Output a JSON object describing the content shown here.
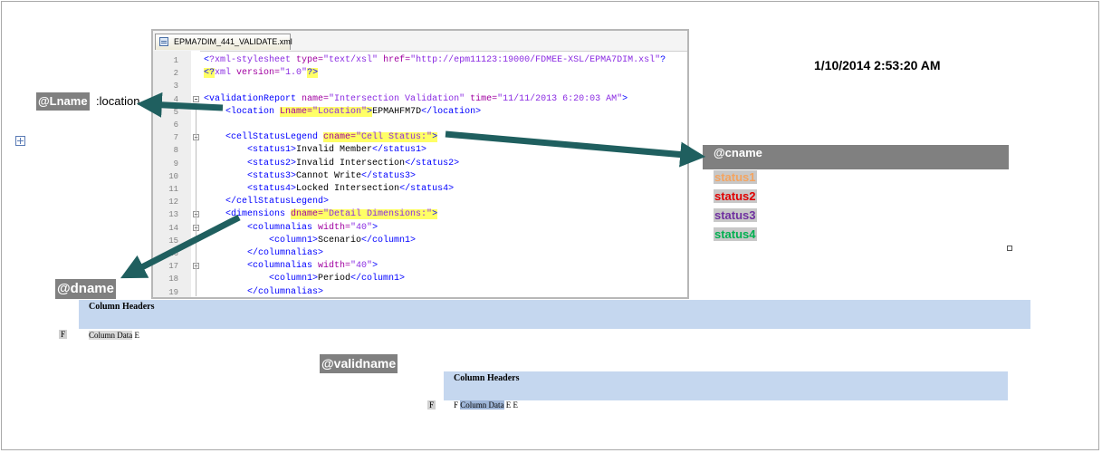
{
  "editor": {
    "tab_title": "EPMA7DIM_441_VALIDATE.xml",
    "lines": [
      {
        "num": "1",
        "parts": [
          {
            "t": "<",
            "c": "c-b"
          },
          {
            "t": "?xml-stylesheet ",
            "c": "c-m"
          },
          {
            "t": "type=",
            "c": "c-p"
          },
          {
            "t": "\"text/xsl\" ",
            "c": "c-m"
          },
          {
            "t": "href=",
            "c": "c-p"
          },
          {
            "t": "\"http://epm11123:19000/FDMEE-XSL/EPMA7DIM.xsl\"",
            "c": "c-m"
          },
          {
            "t": "?",
            "c": "c-b"
          }
        ]
      },
      {
        "num": "2",
        "parts": [
          {
            "t": "<?",
            "c": "c-b hl"
          },
          {
            "t": "xml ",
            "c": "c-m"
          },
          {
            "t": "version=",
            "c": "c-p"
          },
          {
            "t": "\"1.0\"",
            "c": "c-m"
          },
          {
            "t": "?>",
            "c": "c-b hl"
          }
        ]
      },
      {
        "num": "3",
        "parts": []
      },
      {
        "num": "4",
        "parts": [
          {
            "t": "<validationReport ",
            "c": "c-b"
          },
          {
            "t": "name=",
            "c": "c-p"
          },
          {
            "t": "\"Intersection Validation\" ",
            "c": "c-m"
          },
          {
            "t": "time=",
            "c": "c-p"
          },
          {
            "t": "\"11/11/2013 6:20:03 AM\"",
            "c": "c-m"
          },
          {
            "t": ">",
            "c": "c-b"
          }
        ]
      },
      {
        "num": "5",
        "parts": [
          {
            "t": "    <location ",
            "c": "c-b"
          },
          {
            "t": "Lname=",
            "c": "c-p hl"
          },
          {
            "t": "\"Location\"",
            "c": "c-m hl"
          },
          {
            "t": ">",
            "c": "c-b hl"
          },
          {
            "t": "EPMAHFM7D",
            "c": "c-k"
          },
          {
            "t": "</location>",
            "c": "c-b"
          }
        ]
      },
      {
        "num": "6",
        "parts": []
      },
      {
        "num": "7",
        "parts": [
          {
            "t": "    <cellStatusLegend ",
            "c": "c-b"
          },
          {
            "t": "cname=",
            "c": "c-p hl"
          },
          {
            "t": "\"Cell Status:\"",
            "c": "c-m hl"
          },
          {
            "t": ">",
            "c": "c-b hl"
          }
        ]
      },
      {
        "num": "8",
        "parts": [
          {
            "t": "        <status1>",
            "c": "c-b"
          },
          {
            "t": "Invalid Member",
            "c": "c-k"
          },
          {
            "t": "</status1>",
            "c": "c-b"
          }
        ]
      },
      {
        "num": "9",
        "parts": [
          {
            "t": "        <status2>",
            "c": "c-b"
          },
          {
            "t": "Invalid Intersection",
            "c": "c-k"
          },
          {
            "t": "</status2>",
            "c": "c-b"
          }
        ]
      },
      {
        "num": "10",
        "parts": [
          {
            "t": "        <status3>",
            "c": "c-b"
          },
          {
            "t": "Cannot Write",
            "c": "c-k"
          },
          {
            "t": "</status3>",
            "c": "c-b"
          }
        ]
      },
      {
        "num": "11",
        "parts": [
          {
            "t": "        <status4>",
            "c": "c-b"
          },
          {
            "t": "Locked Intersection",
            "c": "c-k"
          },
          {
            "t": "</status4>",
            "c": "c-b"
          }
        ]
      },
      {
        "num": "12",
        "parts": [
          {
            "t": "    </cellStatusLegend>",
            "c": "c-b"
          }
        ]
      },
      {
        "num": "13",
        "parts": [
          {
            "t": "    <dimensions ",
            "c": "c-b"
          },
          {
            "t": "dname=",
            "c": "c-p hl"
          },
          {
            "t": "\"Detail Dimensions:\"",
            "c": "c-m hl"
          },
          {
            "t": ">",
            "c": "c-b hl"
          }
        ]
      },
      {
        "num": "14",
        "parts": [
          {
            "t": "        <columnalias ",
            "c": "c-b"
          },
          {
            "t": "width=",
            "c": "c-p"
          },
          {
            "t": "\"40\"",
            "c": "c-m"
          },
          {
            "t": ">",
            "c": "c-b"
          }
        ]
      },
      {
        "num": "15",
        "parts": [
          {
            "t": "            <column1>",
            "c": "c-b"
          },
          {
            "t": "Scenario",
            "c": "c-k"
          },
          {
            "t": "</column1>",
            "c": "c-b"
          }
        ]
      },
      {
        "num": "16",
        "parts": [
          {
            "t": "        </columnalias>",
            "c": "c-b"
          }
        ]
      },
      {
        "num": "17",
        "parts": [
          {
            "t": "        <columnalias ",
            "c": "c-b"
          },
          {
            "t": "width=",
            "c": "c-p"
          },
          {
            "t": "\"40\"",
            "c": "c-m"
          },
          {
            "t": ">",
            "c": "c-b"
          }
        ]
      },
      {
        "num": "18",
        "parts": [
          {
            "t": "            <column1>",
            "c": "c-b"
          },
          {
            "t": "Period",
            "c": "c-k"
          },
          {
            "t": "</column1>",
            "c": "c-b"
          }
        ]
      },
      {
        "num": "19",
        "parts": [
          {
            "t": "        </columnalias>",
            "c": "c-b"
          }
        ]
      }
    ]
  },
  "report": {
    "date_stamp": "1/10/2014 2:53:20 AM",
    "lname_tag": "@Lname",
    "lname_suffix": ":location",
    "cname_tag": "@cname",
    "statuses": [
      "status1",
      "status2",
      "status3",
      "status4"
    ],
    "status_colors": [
      "#f4a460",
      "#e00000",
      "#7030a0",
      "#00b050"
    ],
    "dname_tag": "@dname",
    "validname_tag": "@validname",
    "column_headers_1": "Column Headers",
    "column_headers_2": "Column Headers",
    "row1": {
      "f": "F",
      "data": "Column Data",
      "e": "E"
    },
    "row2": {
      "f1": "F",
      "f2": "F",
      "data": "Column Data",
      "e1": "E",
      "e2": "E"
    }
  },
  "arrow_color": "#1f5f5f"
}
